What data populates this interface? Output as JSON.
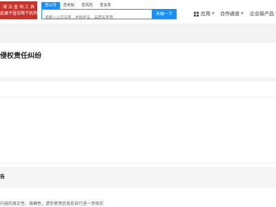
{
  "logo": {
    "line1": "律 法 查 询 工 具",
    "line2": "此展子昼会限下机构"
  },
  "search": {
    "tabs": [
      "查公司",
      "查老板",
      "查风险",
      "查关系"
    ],
    "active_tab": 0,
    "placeholder": "请输入公司名称、老板姓名、品牌名称等",
    "button_label": "天眼一下"
  },
  "nav": {
    "apps": "应用",
    "cooperation": "合作通道",
    "enterprise": "企业级产品"
  },
  "page": {
    "title": "侵权责任纠纷",
    "section_heading": "告",
    "disclaimer": "内容的真实性、准确性，请你使用信息前自行进一步核实"
  },
  "colors": {
    "accent": "#1890ff",
    "logo_bg": "#c8342c",
    "band": "#f3f3f3"
  }
}
